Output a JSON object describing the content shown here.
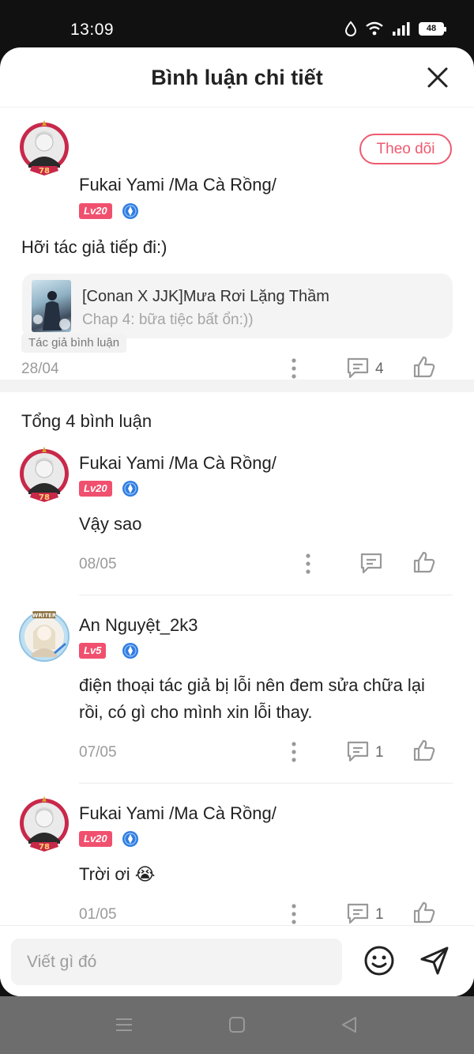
{
  "status": {
    "time": "13:09",
    "battery": "48"
  },
  "header": {
    "title": "Bình luận chi tiết"
  },
  "main_comment": {
    "user": "Fukai Yami /Ma Cà Rồng/",
    "level": "Lv20",
    "follow_label": "Theo dõi",
    "text": "Hỡi tác giả tiếp đi:)",
    "story": {
      "title": "[Conan X JJK]Mưa Rơi Lặng Thầm",
      "chapter": "Chap 4: bữa tiệc bất ổn:))"
    },
    "date": "28/04",
    "reply_count": "4",
    "author_tag": "Tác giả bình luận"
  },
  "replies_header": {
    "total": "Tổng 4 bình luận"
  },
  "replies": [
    {
      "user": "Fukai Yami /Ma Cà Rồng/",
      "level": "Lv20",
      "text": "Vậy sao",
      "date": "08/05",
      "reply_count": ""
    },
    {
      "user": "An Nguyệt_2k3",
      "level": "Lv5",
      "text_line1": "điện thoại tác giả bị lỗi nên đem sửa chữa lại",
      "text_line2": "rồi, có gì cho mình xin lỗi thay.",
      "date": "07/05",
      "reply_count": "1"
    },
    {
      "user": "Fukai Yami /Ma Cà Rồng/",
      "level": "Lv20",
      "text": "Trời ơi 😭",
      "date": "01/05",
      "reply_count": "1"
    }
  ],
  "input": {
    "placeholder": "Viết gì đó"
  },
  "colors": {
    "accent": "#ee5a6f",
    "level_badge": "#f0506e",
    "vip_badge": "#2f7de1"
  }
}
